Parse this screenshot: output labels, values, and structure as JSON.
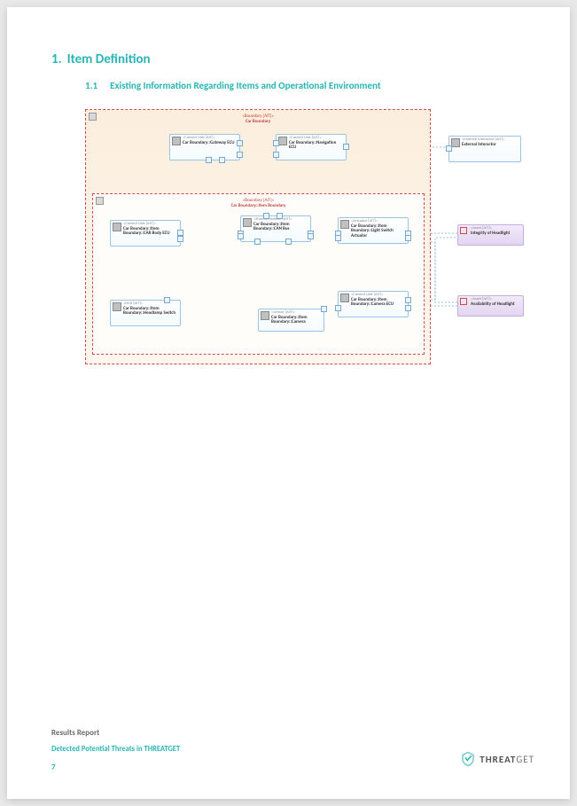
{
  "headings": {
    "h1_num": "1.",
    "h1_text": "Item Definition",
    "h2_num": "1.1",
    "h2_text": "Existing Information Regarding Items and Operational Environment"
  },
  "diagram": {
    "outer_boundary": {
      "stereotype": "«Boundary [AIT]»",
      "name": "Car Boundary"
    },
    "inner_boundary": {
      "stereotype": "«Boundary [AIT]»",
      "name": "Car Boundary::Item Boundary"
    },
    "nodes": {
      "gateway": {
        "stereotype": "«Control Unit [AIT]»",
        "name": "Car Boundary::Gateway ECU"
      },
      "nav": {
        "stereotype": "«Control Unit [AIT]»",
        "name": "Car Boundary::Navigation ECU"
      },
      "external": {
        "stereotype": "«External Interactor [AIT]»",
        "name": "External Interactor"
      },
      "carbody": {
        "stereotype": "«Control Unit [AIT]»",
        "name": "Car Boundary::Item Boundary::CAR Body ECU"
      },
      "canbus": {
        "stereotype": "«Shared Medium [AIT]»",
        "name": "Car Boundary::Item Boundary::CAN Bus"
      },
      "actuator": {
        "stereotype": "«Actuator [AIT]»",
        "name": "Car Boundary::Item Boundary::Light Switch Actuator"
      },
      "hmi": {
        "stereotype": "«HMI [AIT]»",
        "name": "Car Boundary::Item Boundary::Headlamp Switch"
      },
      "camera": {
        "stereotype": "«Sensor [AIT]»",
        "name": "Car Boundary::Item Boundary::Camera"
      },
      "cameraecu": {
        "stereotype": "«Control Unit [AIT]»",
        "name": "Car Boundary::Item Boundary::Camera ECU"
      }
    },
    "assets": {
      "integrity": {
        "stereotype": "«Asset [AIT]»",
        "name": "Integrity of Headlight"
      },
      "availability": {
        "stereotype": "«Asset [AIT]»",
        "name": "Availability of Headlight"
      }
    }
  },
  "footer": {
    "title": "Results Report",
    "subtitle": "Detected Potential Threats in THREATGET",
    "page": "7",
    "brand_left": "THREAT",
    "brand_right": "GET"
  }
}
